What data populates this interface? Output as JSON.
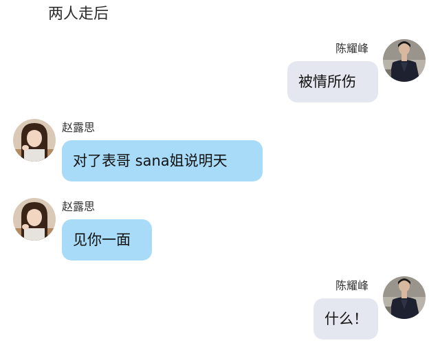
{
  "narration": "两人走后",
  "messages": [
    {
      "side": "right",
      "name": "陈耀峰",
      "text": "被情所伤",
      "avatar": "man-dark-shirt-avatar"
    },
    {
      "side": "left",
      "name": "赵露思",
      "text": "对了表哥 sana姐说明天",
      "avatar": "woman-long-hair-avatar"
    },
    {
      "side": "left",
      "name": "赵露思",
      "text": "见你一面",
      "avatar": "woman-long-hair-avatar"
    },
    {
      "side": "right",
      "name": "陈耀峰",
      "text": "什么！",
      "avatar": "man-dark-shirt-avatar"
    }
  ],
  "colors": {
    "bubble_right": "#e5e7f0",
    "bubble_left": "#a7dbf7",
    "background": "#ffffff"
  }
}
